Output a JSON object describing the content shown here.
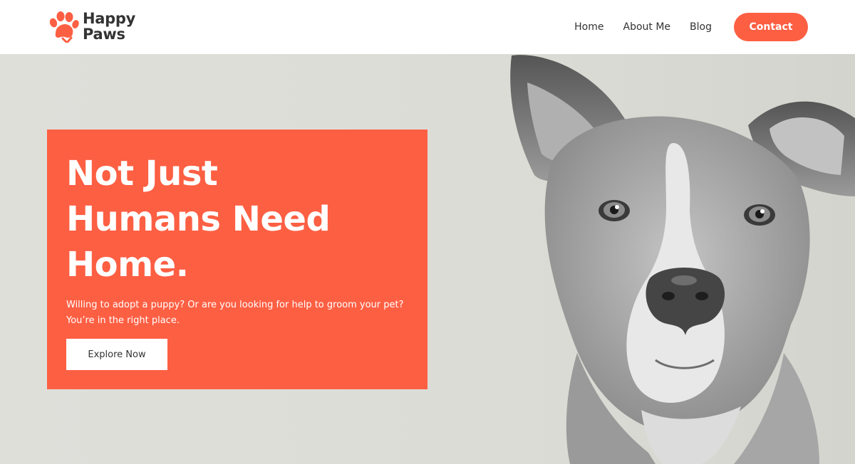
{
  "brand": {
    "name_line1": "Happy",
    "name_line2": "Paws",
    "accent_color": "#fd5f43",
    "logo_icon": "paw-print-icon"
  },
  "nav": {
    "items": [
      {
        "label": "Home"
      },
      {
        "label": "About Me"
      },
      {
        "label": "Blog"
      }
    ],
    "contact_label": "Contact"
  },
  "hero": {
    "headline": [
      "Not Just",
      "Humans Need",
      "Home."
    ],
    "subtext_line1": "Willing to adopt a puppy? Or are you looking for help to groom your pet?",
    "subtext_line2": "You’re in the right place.",
    "cta_label": "Explore Now",
    "image": "grayscale-dog-portrait"
  }
}
